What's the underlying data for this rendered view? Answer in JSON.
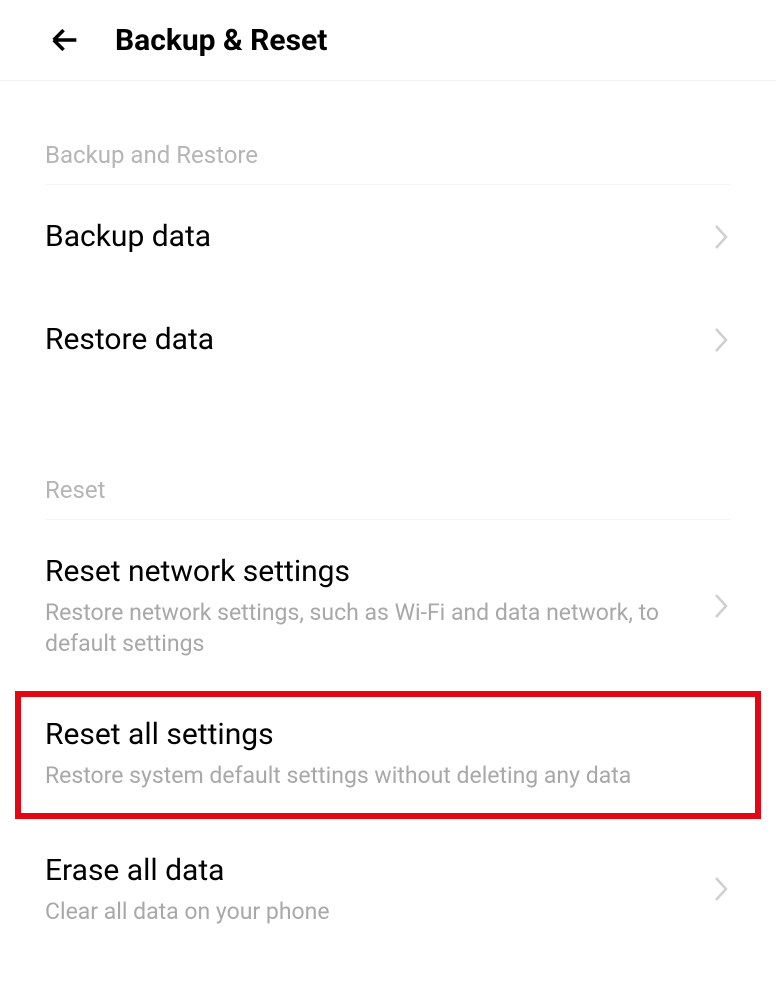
{
  "header": {
    "title": "Backup & Reset"
  },
  "sections": {
    "backup": {
      "label": "Backup and Restore",
      "items": {
        "backup_data": {
          "title": "Backup data"
        },
        "restore_data": {
          "title": "Restore data"
        }
      }
    },
    "reset": {
      "label": "Reset",
      "items": {
        "reset_network": {
          "title": "Reset network settings",
          "subtitle": "Restore network settings, such as Wi-Fi and data network, to default settings"
        },
        "reset_all": {
          "title": "Reset all settings",
          "subtitle": "Restore system default settings without deleting any data"
        },
        "erase_all": {
          "title": "Erase all data",
          "subtitle": "Clear all data on your phone"
        }
      }
    }
  }
}
